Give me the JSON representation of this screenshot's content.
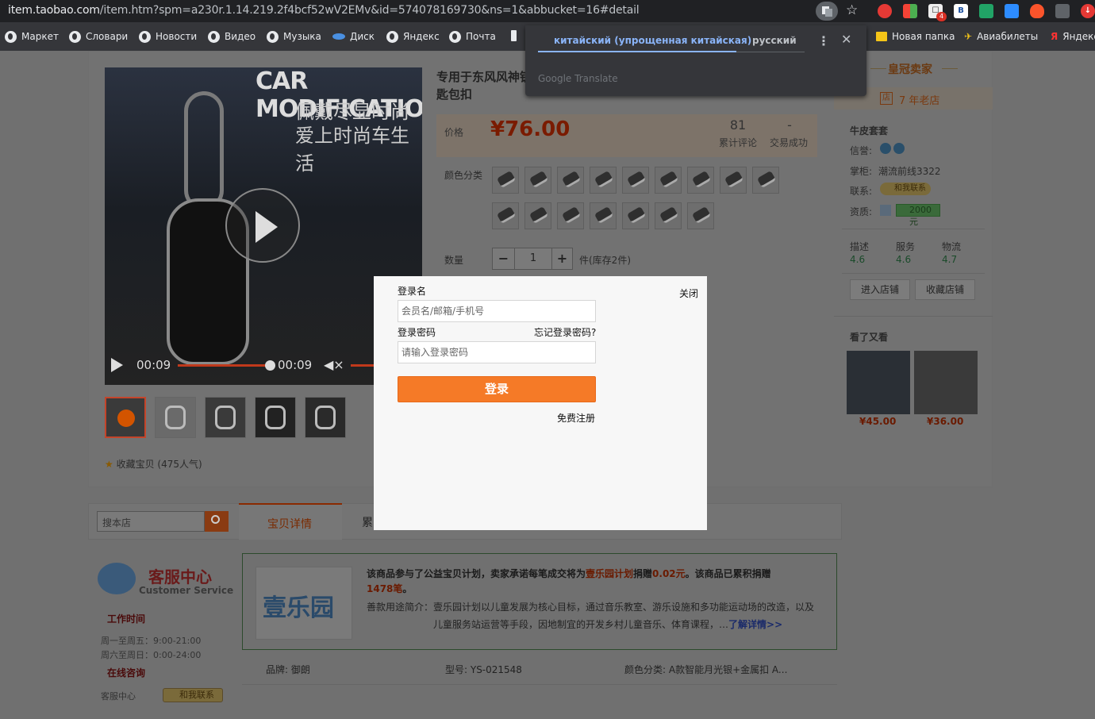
{
  "browser": {
    "url_host": "item.taobao.com",
    "url_path": "/item.htm?spm=a230r.1.14.219.2f4bcf52wV2EMv&id=574078169730&ns=1&abbucket=16#detail",
    "notification_count": "4",
    "bookmarks_left": [
      "Маркет",
      "Словари",
      "Новости",
      "Видео",
      "Музыка",
      "Диск",
      "Яндекс",
      "Почта"
    ],
    "bookmarks_right": [
      "Новая папка",
      "Авиабилеты",
      "Яндекс"
    ]
  },
  "translate": {
    "source_lang": "китайский (упрощенная китайская)",
    "target_lang": "русский",
    "brand": "Google Translate"
  },
  "product": {
    "title": "专用于东风风神钥匙包扣",
    "video_overlay": [
      "CAR MODIFICATIO",
      "佩戴尽显时尚",
      "爱上时尚车生活"
    ],
    "time_current": "00:09",
    "time_total": "00:09",
    "favorite": "收藏宝贝 (475人气)",
    "price_label": "价格",
    "price": "¥76.00",
    "reviews_count": "81",
    "reviews_label": "累计评论",
    "deals_count": "-",
    "deals_label": "交易成功",
    "color_label": "颜色分类",
    "qty_label": "数量",
    "qty_value": "1",
    "qty_minus": "−",
    "qty_plus": "+",
    "stock": "件(库存2件)"
  },
  "shop": {
    "crown": "皇冠卖家",
    "years": "7 年老店",
    "name": "牛皮套套",
    "credit_label": "信誉:",
    "keeper_label": "掌柜:",
    "keeper": "潮流前线3322",
    "contact_label": "联系:",
    "contact_btn": "和我联系",
    "deposit_label": "资质:",
    "deposit": "2000元",
    "ratings": [
      {
        "label": "描述",
        "value": "4.6"
      },
      {
        "label": "服务",
        "value": "4.6"
      },
      {
        "label": "物流",
        "value": "4.7"
      }
    ],
    "enter_store": "进入店铺",
    "fav_store": "收藏店铺",
    "seen_title": "看了又看",
    "seen_items": [
      {
        "price": "¥45.00"
      },
      {
        "price": "¥36.00"
      }
    ]
  },
  "lower": {
    "search_placeholder": "搜本店",
    "tab_detail": "宝贝详情",
    "tab_next": "累",
    "cs_title": "客服中心",
    "cs_sub": "Customer Service",
    "work_hours": "工作时间",
    "weekday": "周一至周五：9:00-21:00",
    "weekend": "周六至周日：0:00-24:00",
    "online": "在线咨询",
    "cs_center": "客服中心",
    "contact_btn": "和我联系",
    "charity_logo": "壹乐园",
    "charity_line1a": "该商品参与了公益宝贝计划，卖家承诺每笔成交将为",
    "charity_link": "壹乐园计划",
    "charity_line1b": "捐赠",
    "charity_amount": "0.02元",
    "charity_line1c": "。该商品已累积捐赠",
    "charity_total": "1478笔",
    "charity_line1d": "。",
    "charity_line2": "善款用途简介：壹乐园计划以儿童发展为核心目标，通过音乐教室、游乐设施和多功能运动场的改造，以及",
    "charity_line3": "儿童服务站运营等手段，因地制宜的开发乡村儿童音乐、体育课程，…",
    "charity_more": "了解详情>>",
    "attr_brand": "品牌: 御朗",
    "attr_model": "型号: YS-021548",
    "attr_color": "颜色分类: A款智能月光银+金属扣 A..."
  },
  "login": {
    "username_label": "登录名",
    "username_placeholder": "会员名/邮箱/手机号",
    "password_label": "登录密码",
    "forgot": "忘记登录密码?",
    "password_placeholder": "请输入登录密码",
    "submit": "登录",
    "register": "免费注册",
    "close": "关闭"
  }
}
